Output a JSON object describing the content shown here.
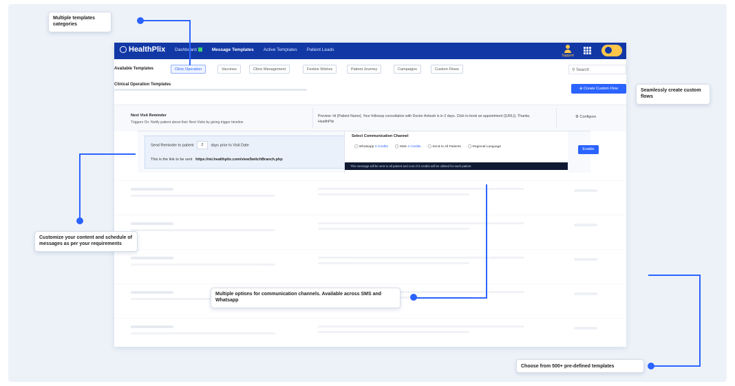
{
  "app": {
    "brand": "HealthPlix",
    "nav": [
      "Dashboard",
      "Message Templates",
      "Active Templates",
      "Patient Leads"
    ],
    "support_label": "Support"
  },
  "tabs": {
    "title": "Available Templates",
    "items": [
      "Clinic Operation",
      "Vaccines",
      "Clinic Management",
      "Festive Wishes",
      "Patient Journey",
      "Campaigns",
      "Custom Flows"
    ],
    "selected": "Clinic Operation",
    "search_placeholder": "Search"
  },
  "section": {
    "title": "Clinical Operation Templates",
    "create_button": "Create Custom Flow"
  },
  "template": {
    "name": "Next Visit Reminder",
    "description": "Triggers On: Notify patient about their Next Visits by giving trigger timeline",
    "preview_label": "Preview:",
    "preview_text": "Hi {Patient Name}, Your followup consultation with Doctor Ankesh is in 2 days. Click to book an appointment {{URL}}. Thanks, HealthPlix",
    "configure": "Configure"
  },
  "config": {
    "send_label": "Send Reminder to patient",
    "days_value": "2",
    "days_suffix": "days prior to Visit Date",
    "link_label": "This is the link to be sent",
    "link_value": "https://mi.healthplix.com/viewSwitchBranch.php",
    "channel_title": "Select Communication Channel",
    "channels": [
      {
        "name": "Whatsapp",
        "credits": "3 Credits"
      },
      {
        "name": "SMS",
        "credits": "2 Credits"
      },
      {
        "name": "Send to All Patients",
        "credits": ""
      },
      {
        "name": "Regional Language",
        "credits": ""
      }
    ],
    "note": "This message will be sent to all patient and cost of 5 credits will be utilised for each patient",
    "enable": "Enable"
  },
  "callouts": {
    "categories": "Multiple templates categories",
    "custom_flows": "Seamlessly create custom flows",
    "customize": "Customize your content and schedule of messages as per your requirements",
    "channels": "Multiple options for communication channels. Available across SMS and Whatsapp",
    "predefined": "Choose from 500+ pre-defined templates"
  },
  "colors": {
    "nav": "#1238a6",
    "accent": "#2b63ff",
    "support": "#ffc64a"
  }
}
